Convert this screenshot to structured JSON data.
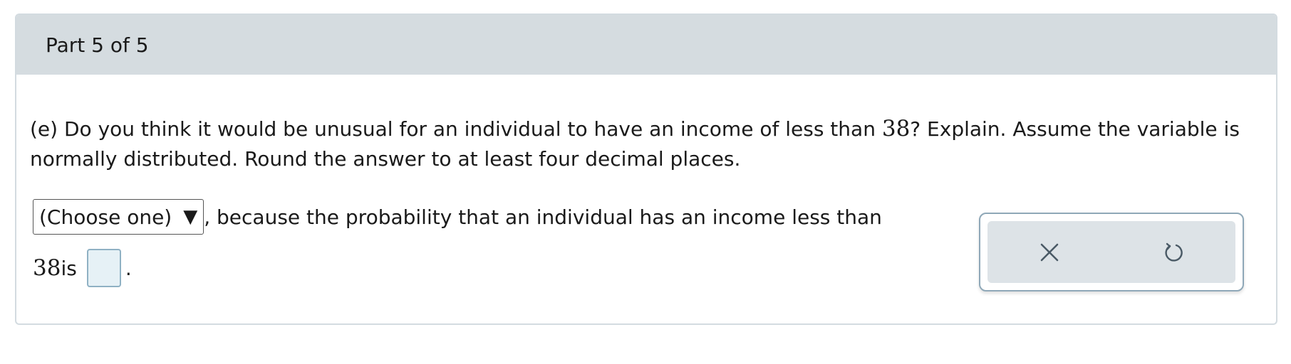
{
  "header": {
    "part_label": "Part 5 of 5"
  },
  "question": {
    "prefix": "(e) Do you think it would be unusual for an individual to have an income of less than ",
    "value": "38",
    "suffix": "? Explain. Assume the variable is normally distributed. Round the answer to at least four decimal places."
  },
  "answer": {
    "dropdown_selected": "(Choose one)",
    "dropdown_arrow": "▼",
    "line1_text": ", because the probability that an individual has an income less than",
    "line2_value": "38",
    "line2_text": " is",
    "period": "."
  },
  "tools": {
    "clear_icon": "close-icon",
    "undo_icon": "undo-icon"
  }
}
